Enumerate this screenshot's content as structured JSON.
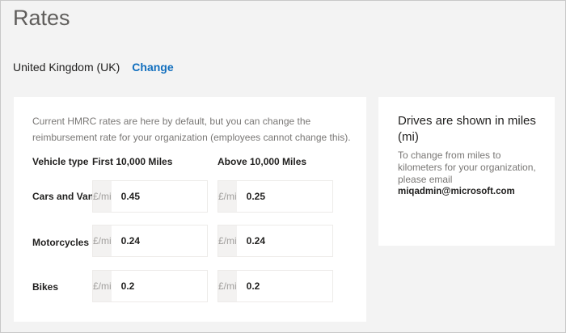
{
  "page": {
    "title": "Rates"
  },
  "country": {
    "name": "United Kingdom (UK)",
    "change_label": "Change"
  },
  "rates_card": {
    "intro": "Current HMRC rates are here by default, but you can change the reimbursement rate for your organization (employees cannot change this).",
    "headers": {
      "vehicle_type": "Vehicle type",
      "first": "First 10,000 Miles",
      "above": "Above 10,000 Miles"
    },
    "unit": "£/mi",
    "rows": [
      {
        "label": "Cars and Vans",
        "first": "0.45",
        "above": "0.25"
      },
      {
        "label": "Motorcycles",
        "first": "0.24",
        "above": "0.24"
      },
      {
        "label": "Bikes",
        "first": "0.2",
        "above": "0.2"
      }
    ]
  },
  "info_card": {
    "title": "Drives are shown in miles (mi)",
    "body": "To change from miles to kilometers for your organization, please email",
    "email": "miqadmin@microsoft.com"
  }
}
